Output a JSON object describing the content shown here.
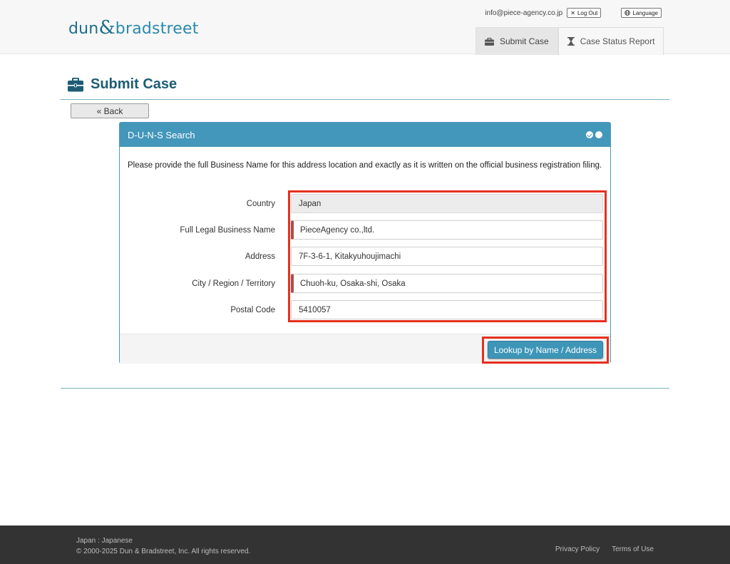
{
  "header": {
    "logo": {
      "part1": "dun",
      "amp": "&",
      "part2": "bradstreet"
    },
    "user_email": "info@piece-agency.co.jp",
    "logout_label": "Log Out",
    "language_label": "Language",
    "tabs": [
      {
        "label": "Submit Case",
        "icon": "briefcase-icon",
        "active": true
      },
      {
        "label": "Case Status Report",
        "icon": "hourglass-icon",
        "active": false
      }
    ]
  },
  "page": {
    "title": "Submit Case",
    "back_label": "« Back"
  },
  "panel": {
    "title": "D-U-N-S Search",
    "instructions": "Please provide the full Business Name for this address location and exactly as it is written on the official business registration filing.",
    "fields": [
      {
        "label": "Country",
        "value": "Japan",
        "readonly": true,
        "required": false
      },
      {
        "label": "Full Legal Business Name",
        "value": "PieceAgency co.,ltd.",
        "readonly": false,
        "required": true
      },
      {
        "label": "Address",
        "value": "7F-3-6-1, Kitakyuhoujimachi",
        "readonly": false,
        "required": false
      },
      {
        "label": "City / Region / Territory",
        "value": "Chuoh-ku, Osaka-shi, Osaka",
        "readonly": false,
        "required": true
      },
      {
        "label": "Postal Code",
        "value": "5410057",
        "readonly": false,
        "required": false
      }
    ],
    "lookup_label": "Lookup by Name / Address"
  },
  "footer": {
    "locale": "Japan : Japanese",
    "copyright": "© 2000-2025 Dun & Bradstreet, Inc. All rights reserved.",
    "privacy_label": "Privacy Policy",
    "terms_label": "Terms of Use"
  },
  "colors": {
    "brand": "#1a6e8c",
    "panel_header": "#4397ba",
    "highlight": "#e5301e",
    "required_marker": "#b24a4a"
  }
}
